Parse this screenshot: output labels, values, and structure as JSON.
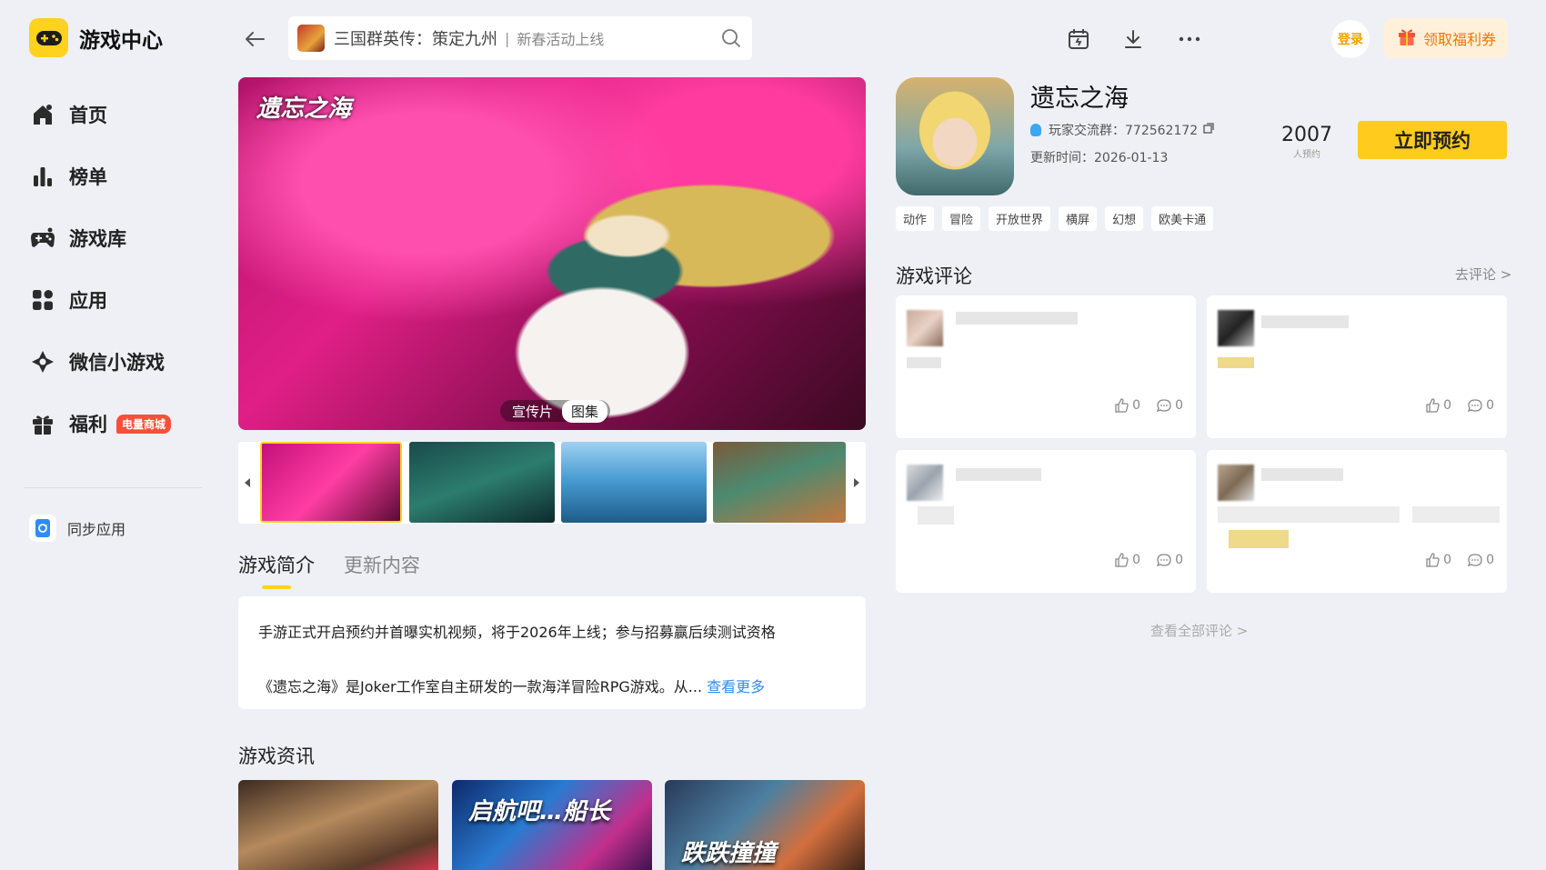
{
  "sidebar": {
    "brand": "游戏中心",
    "items": [
      {
        "label": "首页",
        "icon": "home-icon"
      },
      {
        "label": "榜单",
        "icon": "chart-icon"
      },
      {
        "label": "游戏库",
        "icon": "gamepad-icon"
      },
      {
        "label": "应用",
        "icon": "apps-icon"
      },
      {
        "label": "微信小游戏",
        "icon": "wechat-minigame-icon"
      },
      {
        "label": "福利",
        "icon": "gift-icon",
        "badge": "电量商城"
      }
    ],
    "sync_label": "同步应用"
  },
  "topbar": {
    "search_game": "三国群英传：策定九州",
    "search_hint": "新春活动上线",
    "login": "登录",
    "coupon": "领取福利券"
  },
  "hero": {
    "logo": "遗忘之海",
    "tabs": [
      "宣传片",
      "图集"
    ],
    "active_tab": "图集"
  },
  "detail_tabs": [
    "游戏简介",
    "更新内容"
  ],
  "intro": {
    "line1": "手游正式开启预约并首曝实机视频，将于2026年上线；参与招募赢后续测试资格",
    "line2": "《遗忘之海》是Joker工作室自主研发的一款海洋冒险RPG游戏。从...",
    "more": "查看更多"
  },
  "news": {
    "title": "游戏资讯",
    "cards": [
      "",
      "启航吧…船长",
      "跌跌撞撞"
    ]
  },
  "game": {
    "name": "遗忘之海",
    "group_label": "玩家交流群：772562172",
    "update_label": "更新时间：2026-01-13",
    "reserve_count": "2007",
    "reserve_label": "人预约",
    "reserve_button": "立即预约",
    "tags": [
      "动作",
      "冒险",
      "开放世界",
      "横屏",
      "幻想",
      "欧美卡通"
    ]
  },
  "reviews": {
    "title": "游戏评论",
    "go_comment": "去评论 >",
    "items": [
      {
        "likes": "0",
        "comments": "0"
      },
      {
        "likes": "0",
        "comments": "0"
      },
      {
        "likes": "0",
        "comments": "0"
      },
      {
        "likes": "0",
        "comments": "0"
      }
    ],
    "view_all": "查看全部评论 >"
  },
  "colors": {
    "accent": "#ffd21f",
    "link": "#2f8cf6",
    "badge": "#f5513a"
  }
}
